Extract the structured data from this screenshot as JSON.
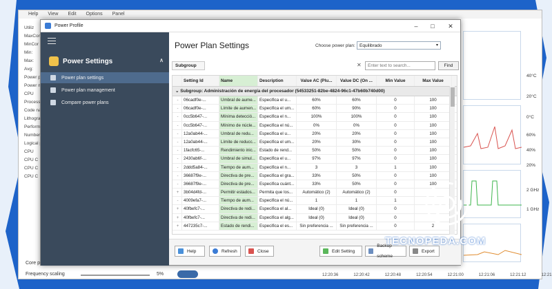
{
  "bg_app": {
    "menu": [
      "Help",
      "View",
      "Edit",
      "Options",
      "Panel"
    ],
    "side_labels": [
      "Utiliz",
      "MaxCor",
      "MinCor",
      "Min:",
      "Max:",
      "Avg:",
      "Power pl",
      "Power m",
      "CPU",
      "Process",
      "Code na",
      "Lithogra",
      "Perform",
      "Number",
      "Logical p",
      "CPU",
      "CPU C",
      "CPU C",
      "CPU C"
    ],
    "right_labels": [
      "40°C",
      "20°C",
      "0°C",
      "60%",
      "40%",
      "20%",
      "2 GHz",
      "1 GHz"
    ],
    "timeline": [
      "12:20:36",
      "12:20:42",
      "12:20:48",
      "12:20:54",
      "12:21:00",
      "12:21:06",
      "12:21:12",
      "12:21:18"
    ],
    "scaling_label": "Frequency scaling",
    "scaling_value": "5%",
    "core_label": "Core pa",
    "ac_label": "AC"
  },
  "window": {
    "title": "Power Profile",
    "sidebar": {
      "heading": "Power Settings",
      "items": [
        {
          "label": "Power plan settings",
          "selected": true
        },
        {
          "label": "Power plan management",
          "selected": false
        },
        {
          "label": "Compare power plans",
          "selected": false
        }
      ]
    },
    "main": {
      "title": "Power Plan Settings",
      "choose_label": "Choose power plan:",
      "plan_value": "Equilibrado",
      "subgroup_btn": "Subgroup",
      "search_placeholder": "Enter text to search...",
      "find_btn": "Find",
      "columns": [
        "Setting Id",
        "Name",
        "Description",
        "Value AC (Plu...",
        "Value DC (On ...",
        "Min Value",
        "Max Value"
      ],
      "subgroup_row": "Subgroup: Administración de energía del procesador (54533251-82be-4824-96c1-47b60b740d00)",
      "rows": [
        {
          "id": "06cadf0e-...",
          "name": "Umbral de aume...",
          "desc": "Especifica el u...",
          "ac": "60%",
          "dc": "60%",
          "min": "0",
          "max": "100",
          "exp": "-"
        },
        {
          "id": "06cadf0e-...",
          "name": "Límite de aumen...",
          "desc": "Especifica el um...",
          "ac": "60%",
          "dc": "90%",
          "min": "0",
          "max": "100",
          "exp": "-"
        },
        {
          "id": "0cc5b647-...",
          "name": "Mínima detecció...",
          "desc": "Especifica el n...",
          "ac": "100%",
          "dc": "100%",
          "min": "0",
          "max": "100",
          "exp": "-"
        },
        {
          "id": "0cc5b647-...",
          "name": "Mínimo de núcle...",
          "desc": "Especifica el nú...",
          "ac": "0%",
          "dc": "0%",
          "min": "0",
          "max": "100",
          "exp": "-"
        },
        {
          "id": "12a0ab44-...",
          "name": "Umbral de redu...",
          "desc": "Especifica el u...",
          "ac": "20%",
          "dc": "20%",
          "min": "0",
          "max": "100",
          "exp": "-"
        },
        {
          "id": "12a0ab44-...",
          "name": "Límite de reducc...",
          "desc": "Especifica el um...",
          "ac": "20%",
          "dc": "30%",
          "min": "0",
          "max": "100",
          "exp": "-"
        },
        {
          "id": "1facfc65-...",
          "name": "Rendimiento inic...",
          "desc": "Estado de rend...",
          "ac": "50%",
          "dc": "50%",
          "min": "0",
          "max": "100",
          "exp": "-"
        },
        {
          "id": "2430ab6f-...",
          "name": "Umbral de simul...",
          "desc": "Especifica el u...",
          "ac": "97%",
          "dc": "97%",
          "min": "0",
          "max": "100",
          "exp": "-"
        },
        {
          "id": "2ddd5a84-...",
          "name": "Tiempo de aum...",
          "desc": "Especifica el n...",
          "ac": "3",
          "dc": "3",
          "min": "1",
          "max": "100",
          "exp": "-"
        },
        {
          "id": "36687f9e-...",
          "name": "Directiva de pre...",
          "desc": "Especifica el gra...",
          "ac": "33%",
          "dc": "50%",
          "min": "0",
          "max": "100",
          "exp": "-"
        },
        {
          "id": "36687f9e-...",
          "name": "Directiva de pre...",
          "desc": "Especifica cuánt...",
          "ac": "33%",
          "dc": "50%",
          "min": "0",
          "max": "100",
          "exp": "-"
        },
        {
          "id": "3b04d4fd-...",
          "name": "Permitir estados...",
          "desc": "Permita que los...",
          "ac": "Automático (2)",
          "dc": "Automático (2)",
          "min": "0",
          "max": "",
          "exp": "+"
        },
        {
          "id": "4009efa7-...",
          "name": "Tiempo de aum...",
          "desc": "Especifica el nú...",
          "ac": "1",
          "dc": "1",
          "min": "1",
          "max": "",
          "exp": "-"
        },
        {
          "id": "40fbefc7-...",
          "name": "Directiva de redi...",
          "desc": "Especifica el al...",
          "ac": "Ideal (0)",
          "dc": "Ideal (0)",
          "min": "0",
          "max": "",
          "exp": "+"
        },
        {
          "id": "40fbefc7-...",
          "name": "Directiva de redi...",
          "desc": "Especifica el alg...",
          "ac": "Ideal (0)",
          "dc": "Ideal (0)",
          "min": "0",
          "max": "",
          "exp": "+"
        },
        {
          "id": "447235c7-...",
          "name": "Estado de rendi...",
          "desc": "Especifica el es...",
          "ac": "Sin preferencia ...",
          "dc": "Sin preferencia ...",
          "min": "0",
          "max": "2",
          "exp": "+"
        }
      ],
      "buttons": {
        "help": "Help",
        "refresh": "Refresh",
        "close": "Close",
        "edit": "Edit Setting",
        "backup": "Backup scheme",
        "export": "Export"
      }
    }
  },
  "watermark": "TECNOPEDA.COM",
  "colors": {
    "bg_blue": "#1d63c9",
    "sidebar": "#3a4a5c",
    "sidebar_sel": "#4e6b8d",
    "name_col": "#d7efd4"
  }
}
